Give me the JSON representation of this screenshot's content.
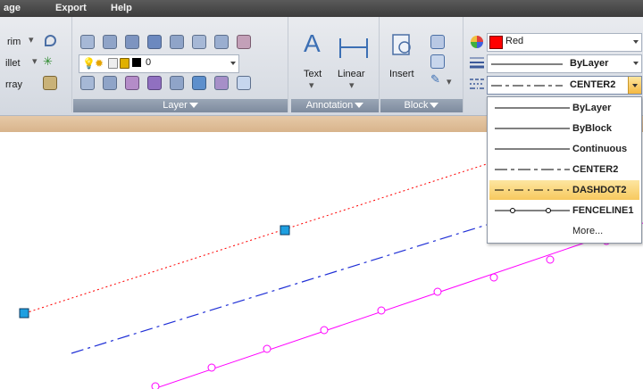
{
  "menubar": {
    "items": [
      "age",
      "Export",
      "Help"
    ]
  },
  "modify_panel": {
    "items": [
      "rim",
      "illet",
      "rray"
    ]
  },
  "layer_panel": {
    "title": "Layer",
    "layer_value": "0"
  },
  "annotation_panel": {
    "title": "Annotation",
    "text_label": "Text",
    "linear_label": "Linear"
  },
  "block_panel": {
    "title": "Block",
    "insert_label": "Insert"
  },
  "properties_panel": {
    "color_value": "Red",
    "lineweight_value": "ByLayer",
    "linetype_value": "CENTER2",
    "colors": {
      "swatch": "#ff0000"
    }
  },
  "linetype_dropdown": {
    "options": [
      {
        "label": "ByLayer",
        "pattern": "solid"
      },
      {
        "label": "ByBlock",
        "pattern": "solid"
      },
      {
        "label": "Continuous",
        "pattern": "solid"
      },
      {
        "label": "CENTER2",
        "pattern": "center"
      },
      {
        "label": "DASHDOT2",
        "pattern": "dashdot"
      },
      {
        "label": "FENCELINE1",
        "pattern": "fence"
      },
      {
        "label": "More...",
        "pattern": "none"
      }
    ],
    "highlighted": "DASHDOT2"
  },
  "drawing": {
    "colors": {
      "red_line": "#ff0000",
      "blue_line": "#1f2fd6",
      "magenta_line": "#ff00ff",
      "grip": "#1e9fe0"
    }
  }
}
